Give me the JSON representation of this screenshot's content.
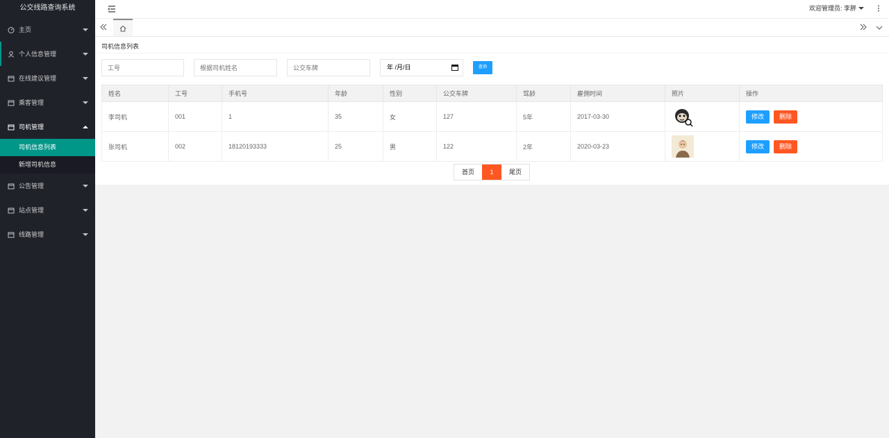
{
  "app": {
    "title": "公交线路查询系统"
  },
  "sidebar": {
    "items": [
      {
        "label": "主页"
      },
      {
        "label": "个人信息管理"
      },
      {
        "label": "在线建议管理"
      },
      {
        "label": "乘客管理"
      },
      {
        "label": "司机管理"
      },
      {
        "label": "公告管理"
      },
      {
        "label": "站点管理"
      },
      {
        "label": "线路管理"
      }
    ],
    "submenu": [
      {
        "label": "司机信息列表"
      },
      {
        "label": "新增司机信息"
      }
    ]
  },
  "header": {
    "user": "欢迎管理员: 李胖"
  },
  "page": {
    "title": "司机信息列表"
  },
  "filters": {
    "job_no_placeholder": "工号",
    "name_placeholder": "根据司机姓名",
    "plate_placeholder": "公交车牌",
    "date_value": "年 /月/日",
    "search_label": "查询"
  },
  "table": {
    "headers": [
      "姓名",
      "工号",
      "手机号",
      "年龄",
      "性别",
      "公交车牌",
      "驾龄",
      "雇佣时间",
      "照片",
      "操作"
    ],
    "rows": [
      {
        "name": "李司机",
        "job_no": "001",
        "phone": "1",
        "age": "35",
        "gender": "女",
        "plate": "127",
        "driving_years": "5年",
        "hire_date": "2017-03-30"
      },
      {
        "name": "张司机",
        "job_no": "002",
        "phone": "18120193333",
        "age": "25",
        "gender": "男",
        "plate": "122",
        "driving_years": "2年",
        "hire_date": "2020-03-23"
      }
    ],
    "edit_label": "修改",
    "delete_label": "删除"
  },
  "pagination": {
    "first": "首页",
    "current": "1",
    "last": "尾页"
  },
  "colors": {
    "sidebar_bg": "#20222a",
    "accent": "#009688",
    "primary_btn": "#1e9fff",
    "danger_btn": "#ff5722"
  }
}
